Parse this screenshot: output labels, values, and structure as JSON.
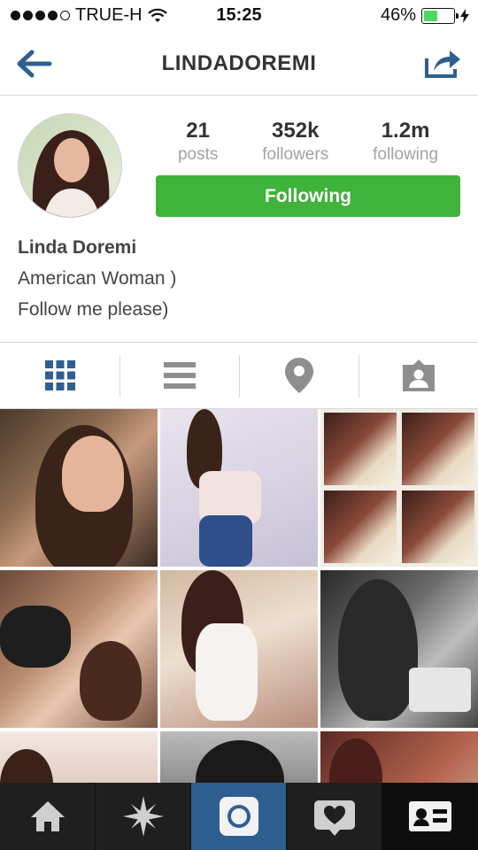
{
  "status_bar": {
    "carrier": "TRUE-H",
    "time": "15:25",
    "battery": "46%",
    "battery_level": 0.46
  },
  "nav": {
    "title": "LINDADOREMI"
  },
  "profile": {
    "stats": [
      {
        "value": "21",
        "label": "posts"
      },
      {
        "value": "352k",
        "label": "followers"
      },
      {
        "value": "1.2m",
        "label": "following"
      }
    ],
    "follow_button": "Following",
    "name": "Linda Doremi",
    "bio_lines": [
      "American Woman )",
      "Follow me please)"
    ]
  },
  "colors": {
    "accent_blue": "#2f5f91",
    "following_green": "#3fb33a",
    "icon_gray": "#8e8e8e"
  },
  "tabs": [
    {
      "icon": "grid-icon",
      "selected": true
    },
    {
      "icon": "list-icon",
      "selected": false
    },
    {
      "icon": "location-pin-icon",
      "selected": false
    },
    {
      "icon": "tagged-photos-icon",
      "selected": false
    }
  ],
  "bottom_nav": [
    {
      "icon": "home-icon"
    },
    {
      "icon": "explore-icon"
    },
    {
      "icon": "camera-icon",
      "selected": true
    },
    {
      "icon": "activity-icon"
    },
    {
      "icon": "profile-icon"
    }
  ]
}
